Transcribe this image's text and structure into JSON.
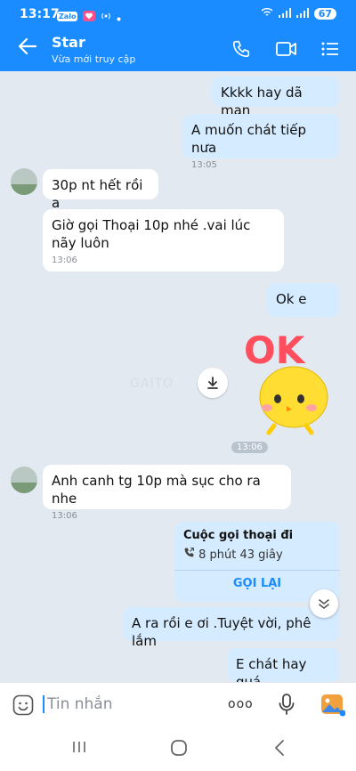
{
  "status": {
    "time": "13:17",
    "battery": "67",
    "mini_badge": "Zalo"
  },
  "header": {
    "title": "Star",
    "subtitle": "Vừa mới truy cập"
  },
  "messages": [
    {
      "text": "Kkkk hay dã man"
    },
    {
      "text": "A muốn chát tiếp nưa",
      "time": "13:05"
    },
    {
      "text": "30p nt hết rồi a"
    },
    {
      "text": "Giờ gọi Thoại 10p nhé .vai lúc nãy luôn",
      "time": "13:06"
    },
    {
      "text": "Ok e"
    },
    {
      "text": "Anh canh tg 10p mà sục cho ra nhe",
      "time": "13:06"
    },
    {
      "text": "A ra rồi e ơi .Tuyệt vời, phê lắm"
    },
    {
      "text": "E chát hay quá"
    }
  ],
  "sticker": {
    "text": "OK",
    "watermark": "GAITO"
  },
  "time_separator": "13:06",
  "call_card": {
    "title": "Cuộc gọi thoại đi",
    "duration": "8 phút 43 giây",
    "action": "GỌI LẠI"
  },
  "input": {
    "placeholder": "Tin nhắn",
    "more": "ooo"
  },
  "colors": {
    "primary": "#1a8cff",
    "background": "#e2e9f1",
    "my_bubble": "#d5ebff",
    "their_bubble": "#ffffff"
  }
}
